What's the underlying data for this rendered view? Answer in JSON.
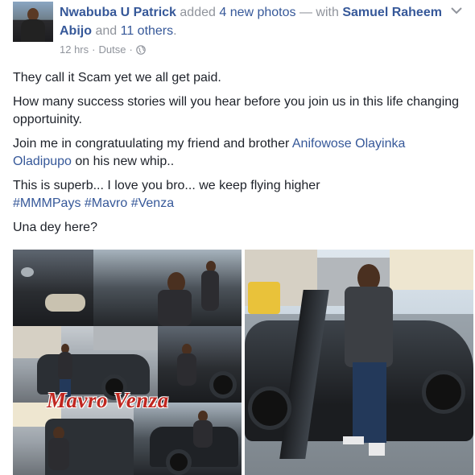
{
  "post": {
    "author": "Nwabuba U Patrick",
    "action_text": "added",
    "photos_link": "4 new photos",
    "with_text": "— with",
    "tagged_person": "Samuel Raheem Abijo",
    "and_text": "and",
    "others_link": "11 others",
    "period": ".",
    "time": "12 hrs",
    "separator": "·",
    "location": "Dutse",
    "separator2": "·",
    "privacy_icon": "globe-icon",
    "menu_icon": "chevron-down-icon"
  },
  "body": {
    "line1": "They call it Scam yet we all get paid.",
    "line2": "How many success stories will you hear before you join us in this life changing opportuinity.",
    "line3_pre": "Join me in congratuulating my friend and brother ",
    "line3_mention": "Anifowose Olayinka Oladipupo",
    "line3_post": " on his new whip..",
    "line4": "This is superb... I love you bro... we keep flying higher",
    "hashtag1": "#MMMPays",
    "hashtag2": "#Mavro",
    "hashtag3": "#Venza",
    "line5": "Una dey here?"
  },
  "photos": {
    "watermark": "Mavro Venza"
  },
  "colors": {
    "link": "#365899",
    "meta": "#90949c",
    "text": "#1d2129",
    "watermark": "#c0261f"
  }
}
